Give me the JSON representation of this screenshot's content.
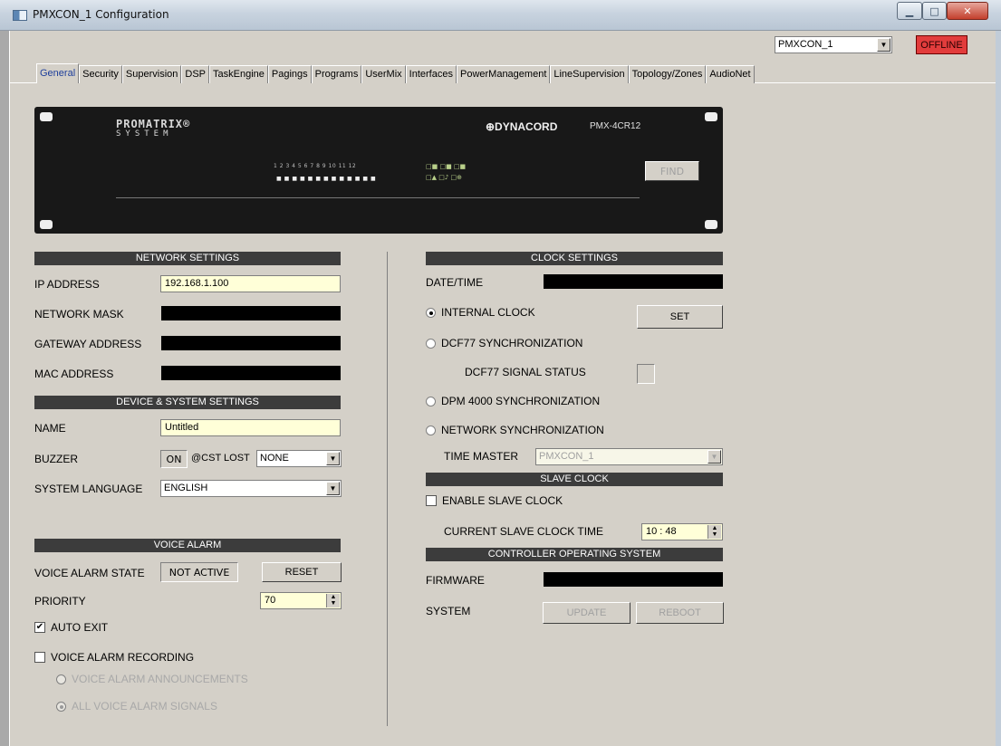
{
  "window": {
    "title": "PMXCON_1 Configuration"
  },
  "top": {
    "device_select": "PMXCON_1",
    "offline_label": "OFFLINE"
  },
  "tabs": [
    "General",
    "Security",
    "Supervision",
    "DSP",
    "TaskEngine",
    "Pagings",
    "Programs",
    "UserMix",
    "Interfaces",
    "PowerManagement",
    "LineSupervision",
    "Topology/Zones",
    "AudioNet"
  ],
  "device": {
    "brand_line1": "PROMATRIX®",
    "brand_line2": "SYSTEM",
    "manufacturer": "⊕DYNACORD",
    "model": "PMX-4CR12",
    "numbers": "1 2 3 4 5 6 7 8 9 10 11 12",
    "find_label": "FIND"
  },
  "network": {
    "header": "NETWORK SETTINGS",
    "ip_label": "IP ADDRESS",
    "ip_value": "192.168.1.100",
    "mask_label": "NETWORK MASK",
    "gateway_label": "GATEWAY ADDRESS",
    "mac_label": "MAC ADDRESS"
  },
  "device_settings": {
    "header": "DEVICE & SYSTEM SETTINGS",
    "name_label": "NAME",
    "name_value": "Untitled",
    "buzzer_label": "BUZZER",
    "buzzer_on": "ON",
    "cst_lost_label": "@CST LOST",
    "cst_lost_value": "NONE",
    "language_label": "SYSTEM LANGUAGE",
    "language_value": "ENGLISH"
  },
  "voice_alarm": {
    "header": "VOICE ALARM",
    "state_label": "VOICE ALARM STATE",
    "state_value": "NOT ACTIVE",
    "reset_label": "RESET",
    "priority_label": "PRIORITY",
    "priority_value": "70",
    "auto_exit_label": "AUTO EXIT",
    "auto_exit_checked": true,
    "recording_label": "VOICE ALARM RECORDING",
    "recording_checked": false,
    "announcements_label": "VOICE ALARM ANNOUNCEMENTS",
    "all_signals_label": "ALL VOICE ALARM SIGNALS"
  },
  "clock": {
    "header": "CLOCK SETTINGS",
    "datetime_label": "DATE/TIME",
    "internal_label": "INTERNAL CLOCK",
    "set_label": "SET",
    "dcf77_label": "DCF77 SYNCHRONIZATION",
    "dcf77_status_label": "DCF77 SIGNAL STATUS",
    "dpm_label": "DPM 4000 SYNCHRONIZATION",
    "network_label": "NETWORK SYNCHRONIZATION",
    "time_master_label": "TIME MASTER",
    "time_master_value": "PMXCON_1",
    "selected": "INTERNAL CLOCK"
  },
  "slave_clock": {
    "header": "SLAVE CLOCK",
    "enable_label": "ENABLE SLAVE CLOCK",
    "enable_checked": false,
    "current_label": "CURRENT SLAVE CLOCK TIME",
    "current_value": "10 : 48"
  },
  "controller_os": {
    "header": "CONTROLLER OPERATING SYSTEM",
    "firmware_label": "FIRMWARE",
    "system_label": "SYSTEM",
    "update_label": "UPDATE",
    "reboot_label": "REBOOT"
  }
}
